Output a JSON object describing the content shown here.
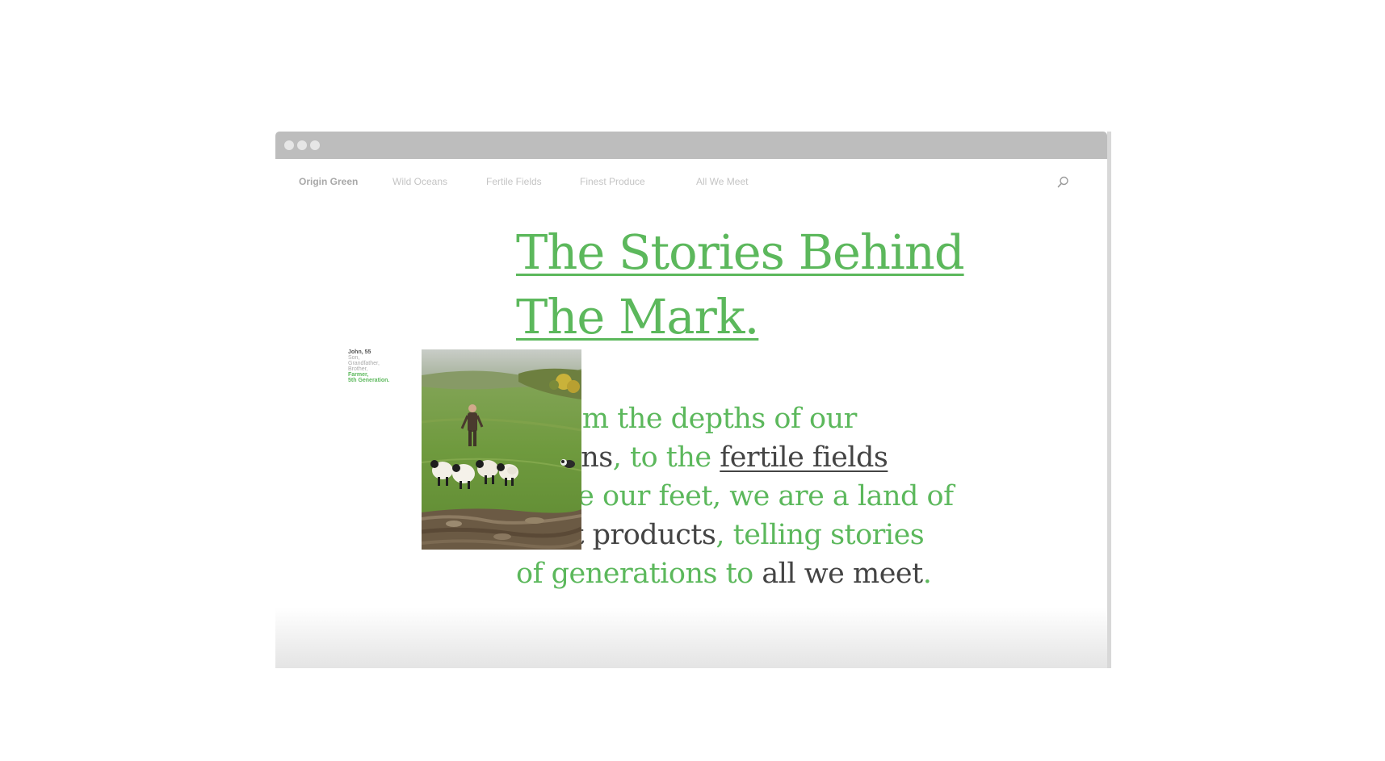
{
  "nav": {
    "brand": "Origin Green",
    "items": [
      "Wild Oceans",
      "Fertile Fields",
      "Finest Produce",
      "All We Meet"
    ]
  },
  "hero": {
    "headline_line1": "The Stories Behind",
    "headline_line2": "The Mark.",
    "body": {
      "l1": "n from the depths of our",
      "l2_a": "oceans",
      "l2_b": ", to the ",
      "l2_link": "fertile fields",
      "l3": "eathe our feet, we are a land of",
      "l4_a": "inest products",
      "l4_b": ", telling stories",
      "l5_a": "of generations to ",
      "l5_b": "all we meet",
      "l5_c": "."
    }
  },
  "caption": {
    "name": "John, 55",
    "lines": [
      "Son,",
      "Grandfather,",
      "Brother,"
    ],
    "role_1": "Farmer,",
    "role_2": "5th Generation."
  },
  "colors": {
    "accent": "#5cb85c",
    "dark_text": "#444444",
    "nav_text": "#c4c4c4",
    "titlebar": "#bdbdbd"
  },
  "icons": {
    "search": "search-icon",
    "window_controls": "window-control-dot"
  }
}
